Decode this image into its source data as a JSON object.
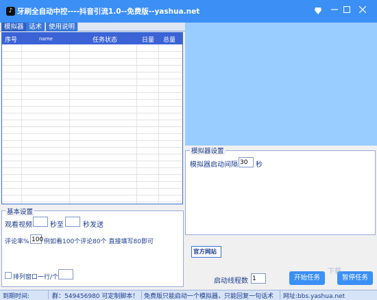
{
  "window": {
    "title": "牙刷全自动中控----抖音引流1.0--免费版--yashua.net",
    "app_icon": "tiktok-icon"
  },
  "tabs": [
    "模拟器",
    "话术",
    "使用说明"
  ],
  "grid": {
    "columns": [
      "序号",
      "name",
      "任务状态",
      "日量",
      "总量"
    ]
  },
  "emulator_settings": {
    "title": "模拟器设置",
    "interval_label": "模拟器启动间隔",
    "interval_value": "30",
    "interval_unit": "秒"
  },
  "basic_settings": {
    "title": "基本设置",
    "watch_label": "观看视频",
    "watch_from": "",
    "watch_to_label": "秒至",
    "watch_to": "",
    "send_label": "秒发送",
    "comment_rate_label": "评论率%",
    "comment_rate_value": "100",
    "comment_rate_hint": "例如看100个评论80个  直接填写80即可",
    "arrange_label": "排列窗口一行/个",
    "arrange_value": ""
  },
  "official_site_label": "官方网站",
  "thread_count_label": "启动线程数",
  "thread_count_value": "1",
  "buttons": {
    "start": "开始任务",
    "pause": "暂停任务"
  },
  "status_bar": {
    "expire": "到期时间:",
    "group": "群：549456980 可定制脚本！",
    "notice": "免费版只能启动一个模拟器，只能回复一句话术",
    "website": "网址:bbs.yashua.net"
  },
  "watermark": "下载",
  "colors": {
    "titlebar": "#3b8ff5",
    "preview": "#99ccff",
    "header": "#3b63d6"
  }
}
